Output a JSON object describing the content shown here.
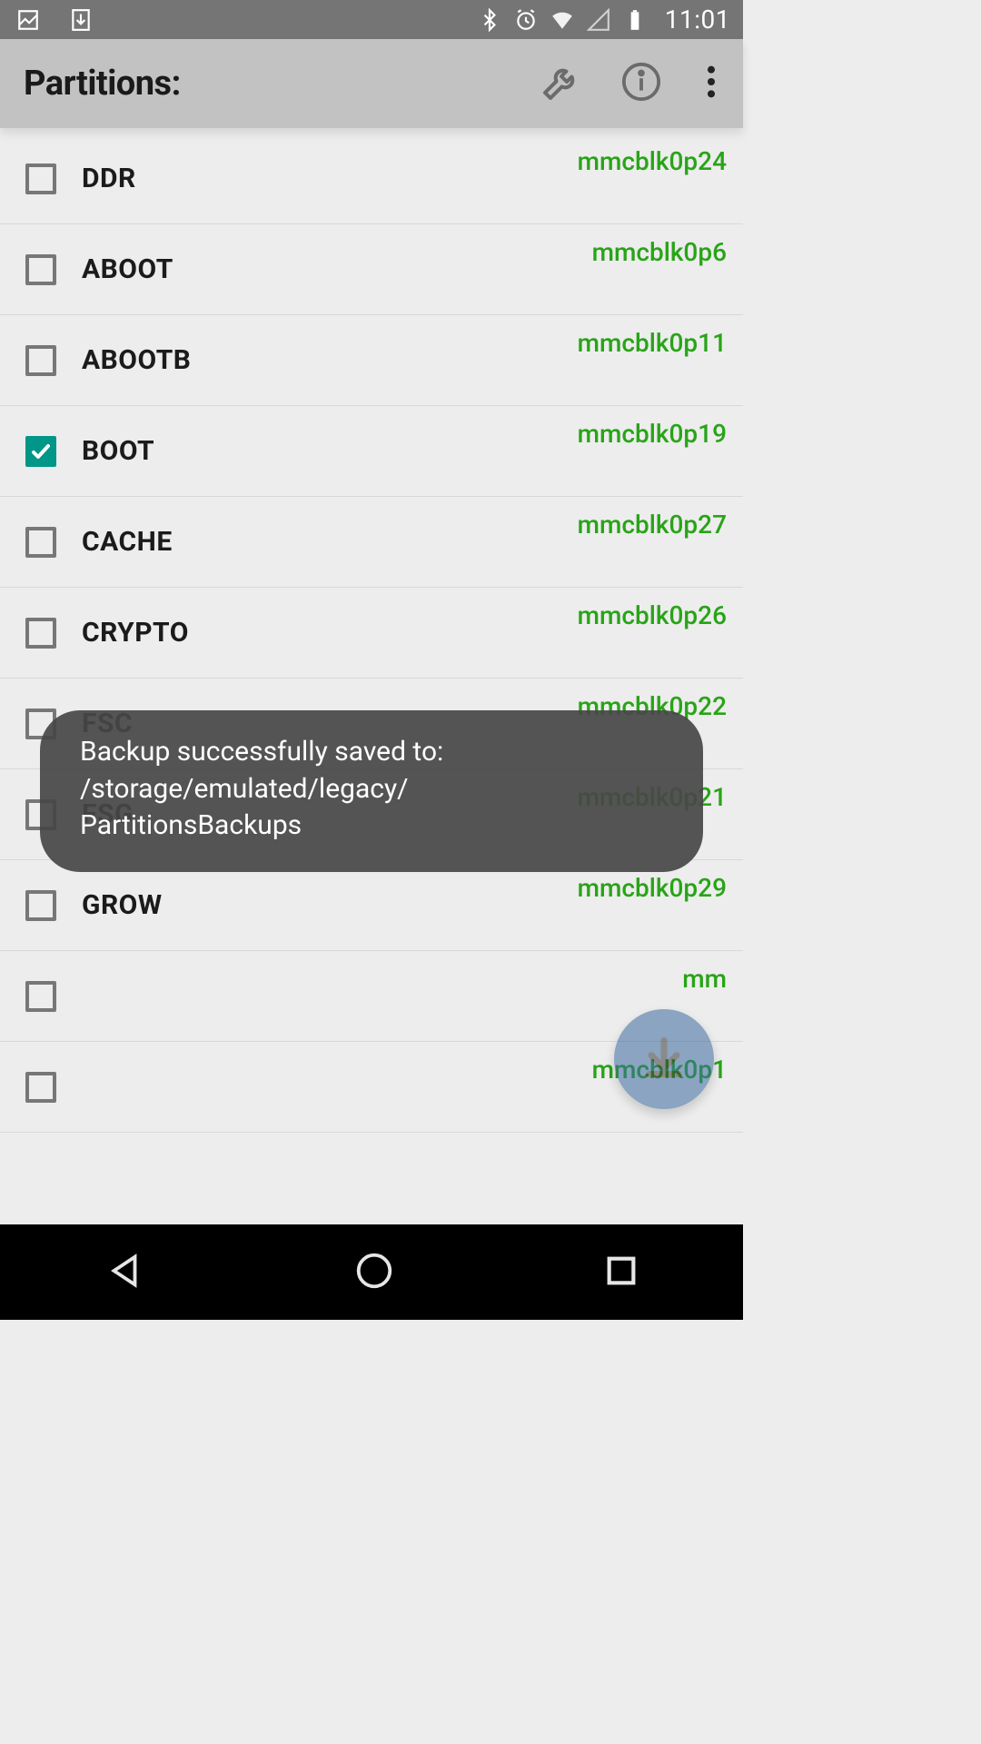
{
  "status": {
    "time": "11:01"
  },
  "header": {
    "title": "Partitions:"
  },
  "partitions": [
    {
      "name": "DDR",
      "device": "mmcblk0p24",
      "checked": false
    },
    {
      "name": "ABOOT",
      "device": "mmcblk0p6",
      "checked": false
    },
    {
      "name": "ABOOTB",
      "device": "mmcblk0p11",
      "checked": false
    },
    {
      "name": "BOOT",
      "device": "mmcblk0p19",
      "checked": true
    },
    {
      "name": "CACHE",
      "device": "mmcblk0p27",
      "checked": false
    },
    {
      "name": "CRYPTO",
      "device": "mmcblk0p26",
      "checked": false
    },
    {
      "name": "FSC",
      "device": "mmcblk0p22",
      "checked": false
    },
    {
      "name": "FSG",
      "device": "mmcblk0p21",
      "checked": false
    },
    {
      "name": "GROW",
      "device": "mmcblk0p29",
      "checked": false
    },
    {
      "name": "",
      "device": "mm",
      "checked": false
    },
    {
      "name": "",
      "device": "mmcblk0p1",
      "checked": false
    }
  ],
  "toast": {
    "line1": "Backup successfully saved to:",
    "line2": "/storage/emulated/legacy/",
    "line3": "PartitionsBackups"
  }
}
